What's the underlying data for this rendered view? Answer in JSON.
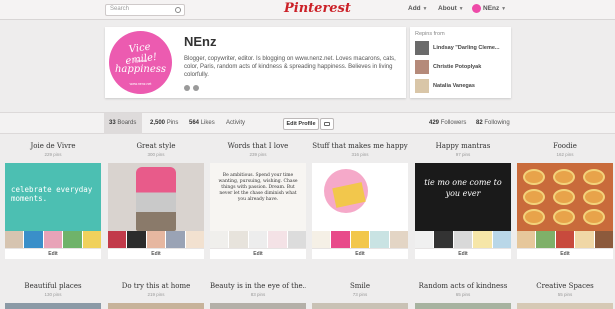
{
  "header": {
    "search_placeholder": "Search",
    "logo": "Pinterest",
    "add": "Add",
    "about": "About",
    "user": "NEnz"
  },
  "profile": {
    "photo_line1": "Vice emile!",
    "photo_line2": "Spread",
    "photo_line3": "happiness",
    "photo_url": "www.nenz.net",
    "name": "NEnz",
    "bio": "Blogger, copywriter, editor. Is blogging on www.nenz.net. Loves macarons, cats, color, Paris, random acts of kindness & spreading happiness. Believes in living colorfully."
  },
  "repins": {
    "title": "Repins from",
    "people": [
      {
        "name": "Lindsay \"Darling Cleme...",
        "color": "#6b6b6b"
      },
      {
        "name": "Christie Potoplyak",
        "color": "#b58a7a"
      },
      {
        "name": "Natalia Vanegas",
        "color": "#d9c6a8"
      }
    ]
  },
  "stats": {
    "boards_num": "33",
    "boards_label": "Boards",
    "pins_num": "2,500",
    "pins_label": "Pins",
    "likes_num": "564",
    "likes_label": "Likes",
    "activity_label": "Activity",
    "edit_profile": "Edit Profile",
    "followers_num": "429",
    "followers_label": "Followers",
    "following_num": "82",
    "following_label": "Following"
  },
  "boards_row1": [
    {
      "title": "Joie de Vivre",
      "count": "229 pins",
      "edit": "Edit",
      "cover_text": "celebrate everyday moments.",
      "cover_color": "#4cbfb2",
      "thumbs": [
        "#d6c4b0",
        "#3a8fc9",
        "#e8a3b8",
        "#6fb36a",
        "#f0d15c"
      ]
    },
    {
      "title": "Great style",
      "count": "300 pins",
      "edit": "Edit",
      "cover_text": "",
      "cover_color": "#d9d3cf",
      "thumbs": [
        "#c23a4a",
        "#2c2c2c",
        "#e6b7a0",
        "#9aa3b5",
        "#f2e1d0"
      ]
    },
    {
      "title": "Words that I love",
      "count": "239 pins",
      "edit": "Edit",
      "cover_text": "Be ambitious. Spend your time wanting, pursuing, wishing. Chase things with passion. Dream. But never let the chase diminish what you already have.",
      "cover_color": "#f7f5f2",
      "thumbs": [
        "#f0efec",
        "#e7e3dc",
        "#ededed",
        "#f4e2e6",
        "#dcdcdc"
      ]
    },
    {
      "title": "Stuff that makes me happy",
      "count": "316 pins",
      "edit": "Edit",
      "cover_text": "",
      "cover_color": "#ffffff",
      "thumbs": [
        "#f5f0e6",
        "#e84b8a",
        "#f2c74c",
        "#c9e3e3",
        "#e3d5c5"
      ]
    },
    {
      "title": "Happy mantras",
      "count": "97 pins",
      "edit": "Edit",
      "cover_text": "tie mo one come to you ever",
      "cover_color": "#1a1a1a",
      "thumbs": [
        "#f0f0f0",
        "#333333",
        "#d9d9d9",
        "#f6e6a8",
        "#b9d7e8"
      ]
    },
    {
      "title": "Foodie",
      "count": "162 pins",
      "edit": "Edit",
      "cover_text": "",
      "cover_color": "#c96b3b",
      "thumbs": [
        "#e6c79b",
        "#7fb069",
        "#c84a3d",
        "#f0d7a6",
        "#8c5a3c"
      ]
    }
  ],
  "boards_row2": [
    {
      "title": "Beautiful places",
      "count": "130 pins"
    },
    {
      "title": "Do try this at home",
      "count": "219 pins"
    },
    {
      "title": "Beauty is in the eye of the...",
      "count": "83 pins"
    },
    {
      "title": "Smile",
      "count": "73 pins"
    },
    {
      "title": "Random acts of kindness",
      "count": "65 pins"
    },
    {
      "title": "Creative Spaces",
      "count": "55 pins"
    }
  ],
  "colors": {
    "brand": "#cb2027",
    "pink": "#ec5bb0"
  }
}
